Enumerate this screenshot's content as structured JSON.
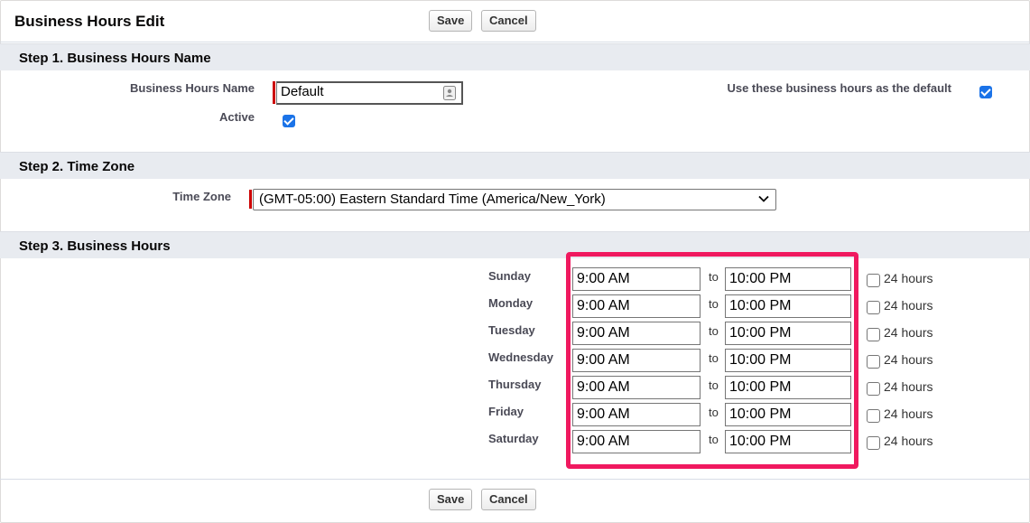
{
  "header": {
    "title": "Business Hours Edit",
    "save_label": "Save",
    "cancel_label": "Cancel"
  },
  "step1": {
    "heading": "Step 1. Business Hours Name",
    "name_label": "Business Hours Name",
    "name_value": "Default",
    "active_label": "Active",
    "active_checked": true,
    "default_label": "Use these business hours as the default",
    "default_checked": true
  },
  "step2": {
    "heading": "Step 2. Time Zone",
    "tz_label": "Time Zone",
    "tz_value": "(GMT-05:00) Eastern Standard Time (America/New_York)"
  },
  "step3": {
    "heading": "Step 3. Business Hours",
    "to_label": "to",
    "h24_label": "24 hours",
    "days": [
      {
        "day": "Sunday",
        "start": "9:00 AM",
        "end": "10:00 PM",
        "all_day": false
      },
      {
        "day": "Monday",
        "start": "9:00 AM",
        "end": "10:00 PM",
        "all_day": false
      },
      {
        "day": "Tuesday",
        "start": "9:00 AM",
        "end": "10:00 PM",
        "all_day": false
      },
      {
        "day": "Wednesday",
        "start": "9:00 AM",
        "end": "10:00 PM",
        "all_day": false
      },
      {
        "day": "Thursday",
        "start": "9:00 AM",
        "end": "10:00 PM",
        "all_day": false
      },
      {
        "day": "Friday",
        "start": "9:00 AM",
        "end": "10:00 PM",
        "all_day": false
      },
      {
        "day": "Saturday",
        "start": "9:00 AM",
        "end": "10:00 PM",
        "all_day": false
      }
    ]
  },
  "footer": {
    "save_label": "Save",
    "cancel_label": "Cancel"
  },
  "colors": {
    "highlight": "#f0195f",
    "checkbox": "#1b73e8",
    "required": "#cc0000",
    "section_bg": "#e8ebf0"
  },
  "icons": {
    "field_icon": "contact-card-icon",
    "dropdown": "chevron-down-icon",
    "check": "checkmark-icon"
  }
}
